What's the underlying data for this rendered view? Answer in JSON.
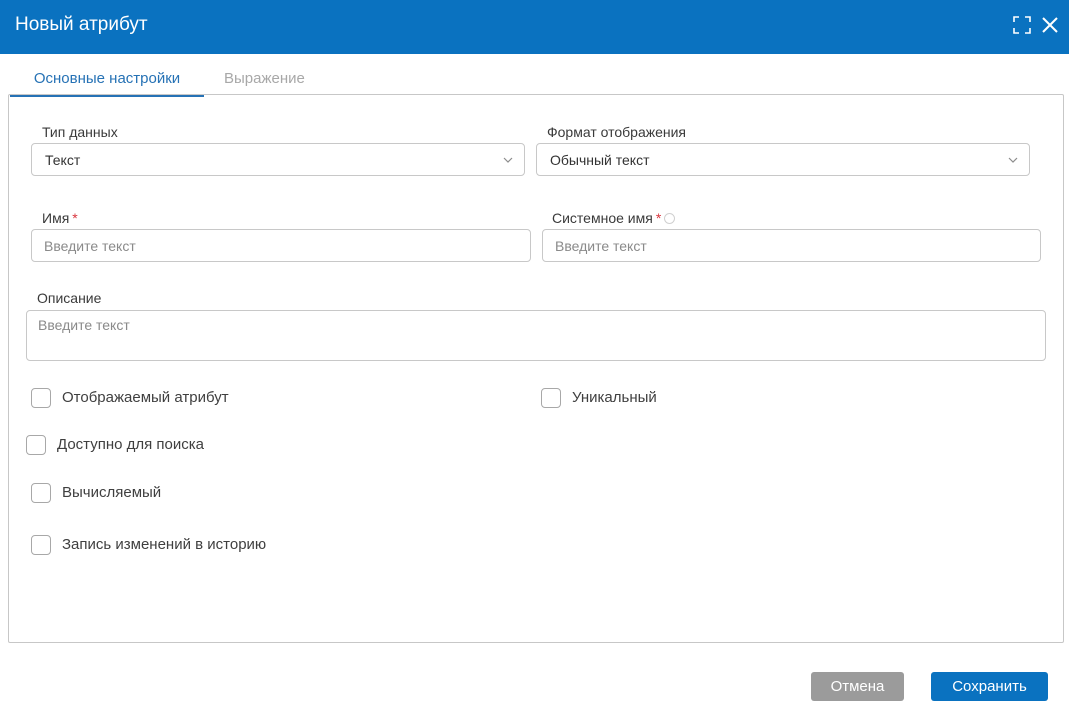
{
  "window": {
    "title": "Новый атрибут",
    "expand_icon": "expand-icon",
    "close_icon": "close-icon",
    "accent_color": "#0a72c0"
  },
  "tabs": [
    {
      "label": "Основные настройки",
      "active": true
    },
    {
      "label": "Выражение",
      "active": false
    }
  ],
  "form": {
    "data_type": {
      "label": "Тип данных",
      "value": "Текст"
    },
    "display_format": {
      "label": "Формат отображения",
      "value": "Обычный текст"
    },
    "name": {
      "label": "Имя",
      "required_mark": "*",
      "placeholder": "Введите текст",
      "value": ""
    },
    "system_name": {
      "label": "Системное имя",
      "required_mark": "*",
      "placeholder": "Введите текст",
      "value": "",
      "hint_icon": "info-icon"
    },
    "description": {
      "label": "Описание",
      "placeholder": "Введите текст",
      "value": ""
    },
    "checkboxes": {
      "displayed": {
        "label": "Отображаемый атрибут",
        "checked": false
      },
      "unique": {
        "label": "Уникальный",
        "checked": false
      },
      "searchable": {
        "label": "Доступно для поиска",
        "checked": false
      },
      "computed": {
        "label": "Вычисляемый",
        "checked": false
      },
      "history": {
        "label": "Запись изменений в историю",
        "checked": false
      }
    }
  },
  "footer": {
    "cancel_label": "Отмена",
    "save_label": "Сохранить"
  }
}
